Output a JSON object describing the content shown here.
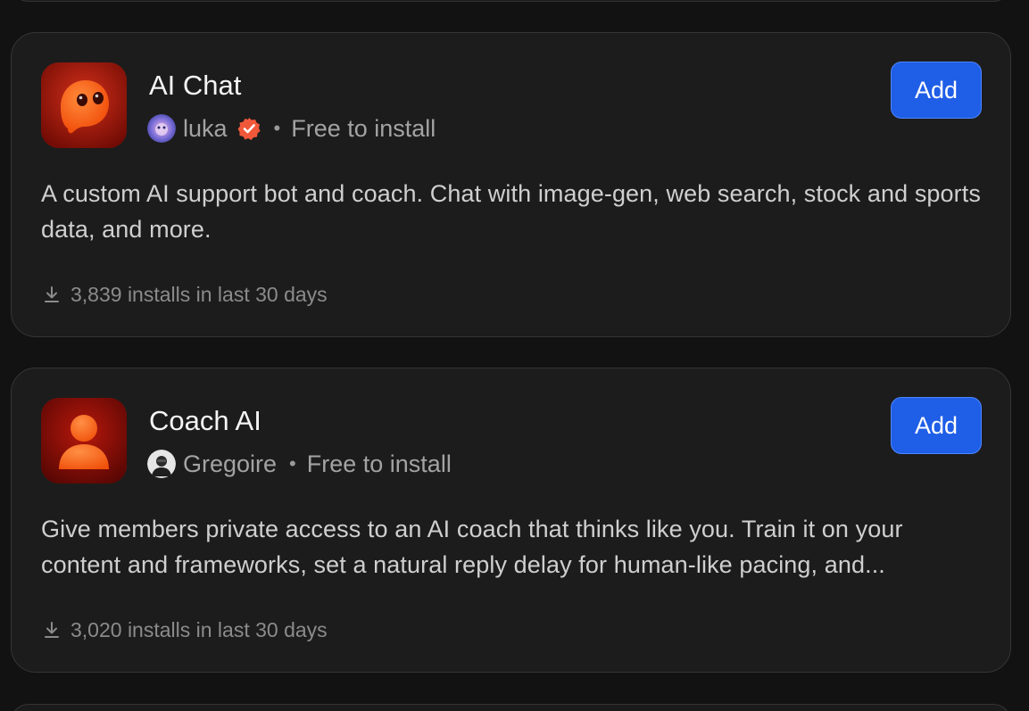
{
  "apps": [
    {
      "name": "AI Chat",
      "author": "luka",
      "verified": true,
      "price": "Free to install",
      "separator": "•",
      "add_label": "Add",
      "description": "A custom AI support bot and coach. Chat with image-gen, web search, stock and sports data, and more.",
      "installs": "3,839 installs in last 30 days",
      "icon": "ghost-icon",
      "icon_colors": {
        "bg": "#b31d0c",
        "fg": "#ff6a1a"
      }
    },
    {
      "name": "Coach AI",
      "author": "Gregoire",
      "verified": false,
      "price": "Free to install",
      "separator": "•",
      "add_label": "Add",
      "description": "Give members private access to an AI coach that thinks like you. Train it on your content and frameworks, set a natural reply delay for human-like pacing, and...",
      "installs": "3,020 installs in last 30 days",
      "icon": "person-icon",
      "icon_colors": {
        "bg": "#8a0f08",
        "fg": "#ff6417"
      }
    }
  ],
  "colors": {
    "background": "#121212",
    "card": "#1c1c1c",
    "border": "#353535",
    "accent_button": "#1f5ee6",
    "verified_badge": "#f0583a",
    "muted_text": "#a3a3a3"
  }
}
